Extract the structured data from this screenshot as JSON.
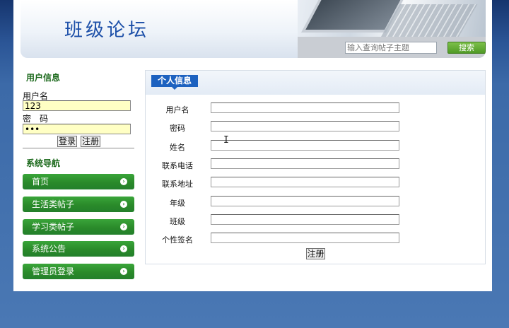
{
  "header": {
    "title": "班级论坛",
    "search_placeholder": "输入查询帖子主题",
    "search_button": "搜索"
  },
  "sidebar": {
    "user_info_heading": "用户信息",
    "username_label": "用户名",
    "username_value": "123",
    "password_label": "密　码",
    "password_value": "•••",
    "login_button": "登录",
    "register_button": "注册",
    "nav_heading": "系统导航",
    "nav_items": [
      {
        "label": "首页"
      },
      {
        "label": "生活类帖子"
      },
      {
        "label": "学习类帖子"
      },
      {
        "label": "系统公告"
      },
      {
        "label": "管理员登录"
      }
    ]
  },
  "main": {
    "tab_title": "个人信息",
    "fields": [
      {
        "label": "用户名",
        "value": ""
      },
      {
        "label": "密码",
        "value": ""
      },
      {
        "label": "姓名",
        "value": ""
      },
      {
        "label": "联系电话",
        "value": ""
      },
      {
        "label": "联系地址",
        "value": ""
      },
      {
        "label": "年级",
        "value": ""
      },
      {
        "label": "班级",
        "value": ""
      },
      {
        "label": "个性签名",
        "value": ""
      }
    ],
    "submit_button": "注册"
  },
  "colors": {
    "accent_blue": "#1d62c0",
    "nav_green": "#2a8a2a",
    "input_yellow": "#ffffc4",
    "heading_green": "#1d6a1d"
  },
  "icons": {
    "nav_arrow": "chevron-right-circle-icon"
  }
}
